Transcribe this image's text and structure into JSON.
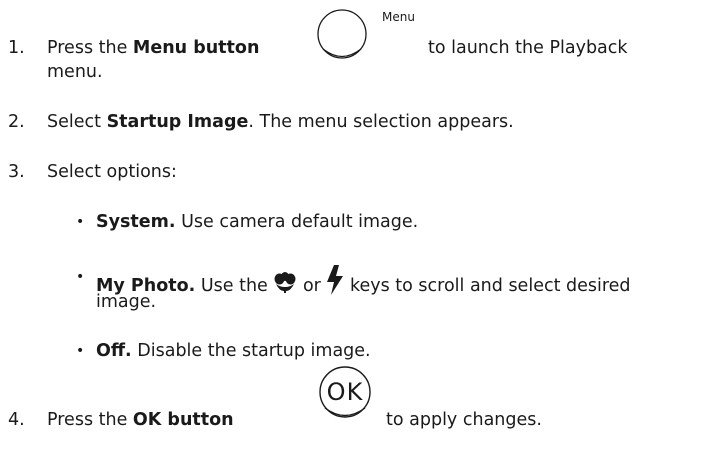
{
  "steps": [
    {
      "number": "1.",
      "prefix": "Press the ",
      "bold": "Menu button",
      "icon_caption": "Menu",
      "suffix": "to launch the Playback",
      "continuation": "menu."
    },
    {
      "number": "2.",
      "prefix": "Select ",
      "bold": "Startup Image",
      "suffix": ". The menu selection appears."
    },
    {
      "number": "3.",
      "text": "Select options:",
      "options": [
        {
          "bullet": "•",
          "bold": "System.",
          "text": " Use camera default image."
        },
        {
          "bullet": "•",
          "bold": "My Photo.",
          "text_before_icon": " Use the ",
          "icon1": "macro-flower-icon",
          "text_between": " or ",
          "icon2": "flash-bolt-icon",
          "text_after": " keys to scroll and select desired",
          "continuation": "image."
        },
        {
          "bullet": "•",
          "bold": "Off.",
          "text": " Disable the startup image."
        }
      ]
    },
    {
      "number": "4.",
      "prefix": "Press the ",
      "bold": "OK button",
      "icon_label": "OK",
      "suffix": "to apply changes."
    }
  ]
}
